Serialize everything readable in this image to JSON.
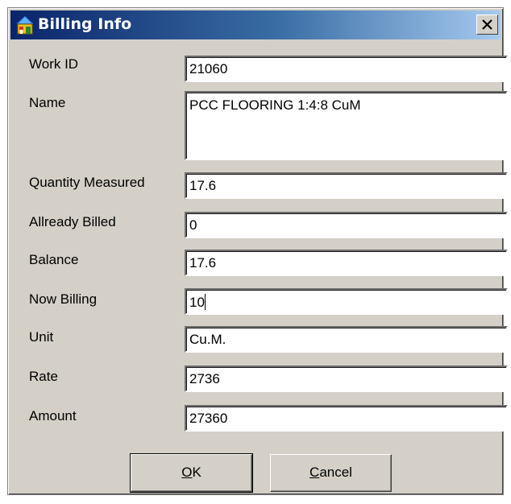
{
  "window": {
    "title": "Billing Info",
    "icon": "app-house-icon",
    "close_icon": "close-icon"
  },
  "fields": {
    "work_id": {
      "label": "Work ID",
      "value": "21060"
    },
    "name": {
      "label": "Name",
      "value": "PCC FLOORING 1:4:8 CuM"
    },
    "quantity_measured": {
      "label": "Quantity Measured",
      "value": "17.6"
    },
    "already_billed": {
      "label": "Allready Billed",
      "value": "0"
    },
    "balance": {
      "label": "Balance",
      "value": "17.6"
    },
    "now_billing": {
      "label": "Now Billing",
      "value": "10"
    },
    "unit": {
      "label": "Unit",
      "value": "Cu.M."
    },
    "rate": {
      "label": "Rate",
      "value": "2736"
    },
    "amount": {
      "label": "Amount",
      "value": "27360"
    }
  },
  "buttons": {
    "ok": {
      "mnemonic": "O",
      "rest": "K"
    },
    "cancel": {
      "mnemonic": "C",
      "rest": "ancel"
    }
  },
  "colors": {
    "titlebar_start": "#0a246a",
    "titlebar_end": "#a6caf0",
    "face": "#d4d0c8"
  }
}
